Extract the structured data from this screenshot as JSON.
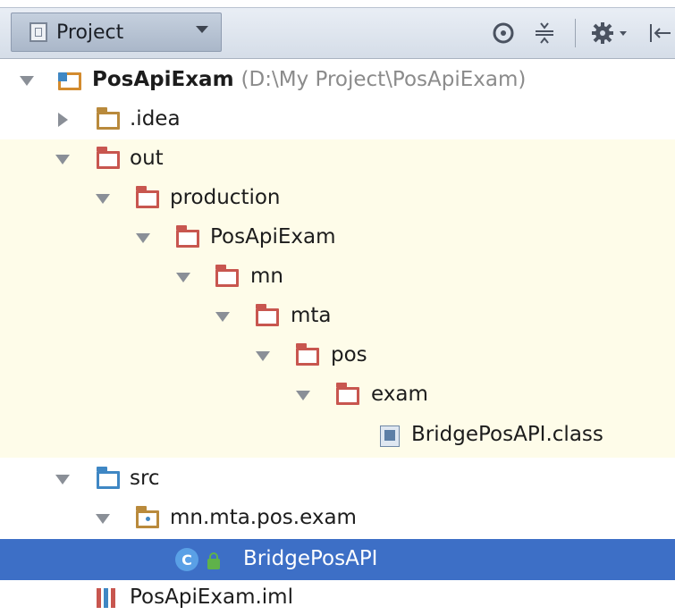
{
  "toolbar": {
    "project_label": "Project",
    "icons": [
      "crosshair-icon",
      "collapse-icon",
      "gear-icon",
      "hide-panel-icon"
    ]
  },
  "tree": {
    "root_name": "PosApiExam",
    "root_path": "(D:\\My Project\\PosApiExam)",
    "idea": ".idea",
    "out": "out",
    "production": "production",
    "posapiexam": "PosApiExam",
    "mn": "mn",
    "mta": "mta",
    "pos": "pos",
    "exam": "exam",
    "class_file": "BridgePosAPI.class",
    "src": "src",
    "package": "mn.mta.pos.exam",
    "class": "BridgePosAPI",
    "iml": "PosApiExam.iml"
  },
  "colors": {
    "selection": "#3d6fc6",
    "highlight": "#fefce9",
    "folder_red": "#c8564f",
    "folder_blue": "#3f87c4"
  }
}
